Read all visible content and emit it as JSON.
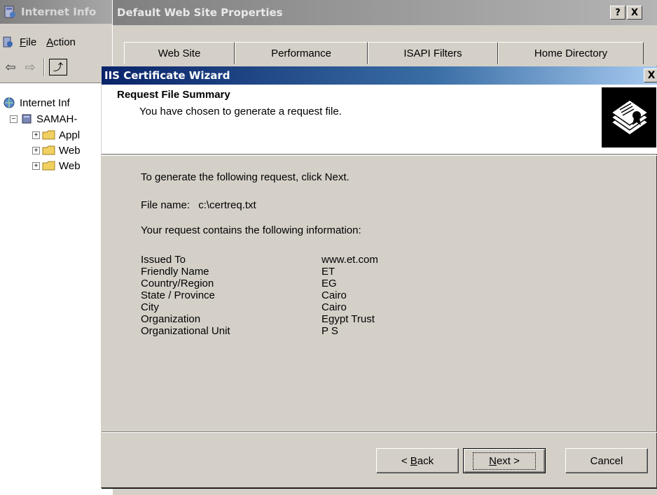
{
  "mmc": {
    "title": "Internet Info",
    "menus": [
      "File",
      "Action"
    ],
    "tree": [
      {
        "label": "Internet Inf",
        "level": 0,
        "expander": ""
      },
      {
        "label": "SAMAH-",
        "level": 1,
        "expander": "−"
      },
      {
        "label": "Appl",
        "level": 2,
        "expander": "+"
      },
      {
        "label": "Web",
        "level": 2,
        "expander": "+"
      },
      {
        "label": "Web",
        "level": 2,
        "expander": "+"
      }
    ]
  },
  "properties": {
    "title": "Default Web Site Properties",
    "help_button": "?",
    "close_button": "X",
    "tabs": [
      "Web Site",
      "Performance",
      "ISAPI Filters",
      "Home Directory"
    ]
  },
  "wizard": {
    "title": "IIS Certificate Wizard",
    "close_button": "X",
    "heading": "Request File Summary",
    "subheading": "You have chosen to generate a request file.",
    "instruction": "To generate the following request, click Next.",
    "file_name_label": "File name:",
    "file_name_value": "c:\\certreq.txt",
    "info_intro": "Your request contains the following information:",
    "info": [
      {
        "label": "Issued To",
        "value": "www.et.com"
      },
      {
        "label": "Friendly Name",
        "value": "ET"
      },
      {
        "label": "Country/Region",
        "value": "EG"
      },
      {
        "label": "State / Province",
        "value": "Cairo"
      },
      {
        "label": "City",
        "value": "Cairo"
      },
      {
        "label": "Organization",
        "value": "Egypt Trust"
      },
      {
        "label": "Organizational Unit",
        "value": "P S"
      }
    ],
    "buttons": {
      "back_prefix": "< ",
      "back_accel": "B",
      "back_rest": "ack",
      "next_accel": "N",
      "next_rest": "ext >",
      "cancel": "Cancel"
    }
  }
}
